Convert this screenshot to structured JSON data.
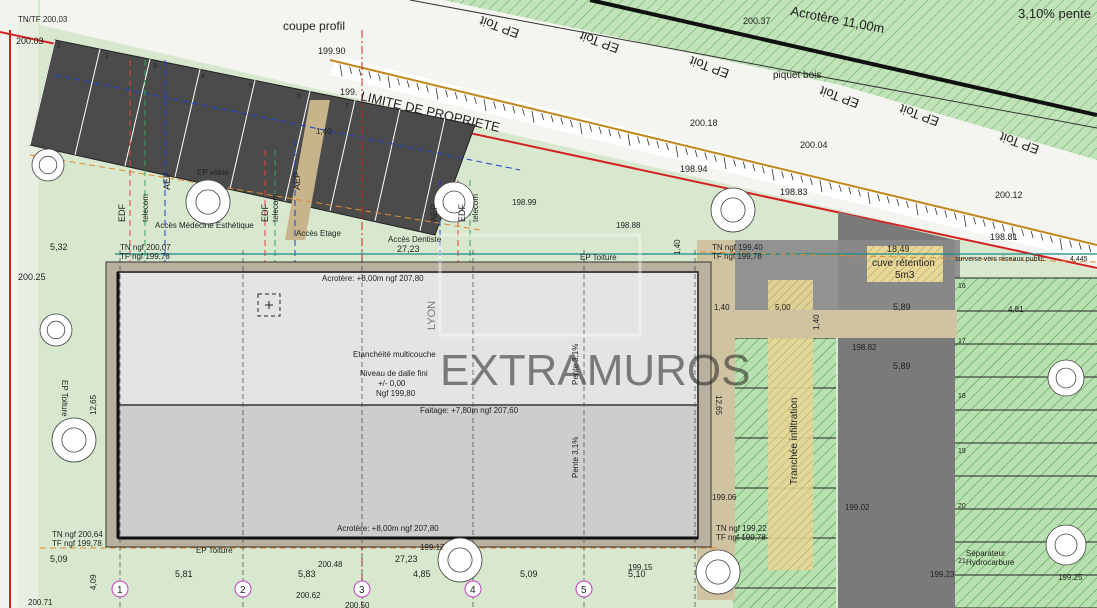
{
  "labels": {
    "tn_top_left": "TN/TF 200,03",
    "lvl_200_03": "200.03",
    "coupe_profil": "coupe profil",
    "lvl_199_90": "199.90",
    "lvl_199_xx": "199.",
    "limite_propriete": "LIMITE DE PROPRIETE",
    "acrotere_top": "Acrotère 11,00m",
    "pente_top": "3,10% pente",
    "lvl_200_37": "200.37",
    "piquet_bois": "piquet bois",
    "lvl_200_18": "200.18",
    "lvl_200_04": "200.04",
    "lvl_198_94": "198.94",
    "lvl_198_83": "198.83",
    "lvl_200_12": "200.12",
    "lvl_198_81": "198.81",
    "lvl_198_88": "198.88",
    "lvl_198_99": "198.99",
    "dim_1_40_top": "1,40",
    "ep_voirie": "EP voirie",
    "edf_1": "EDF",
    "telecom_1": "telecom",
    "aep_1": "AEP",
    "edf_2": "EDF",
    "telecom_2": "telecom",
    "aep_2": "AEP",
    "aep_3": "AEP",
    "edf_3": "EDF",
    "telecom_3": "telecom",
    "acces_medecine": "Accès Médecine Esthétique",
    "acces_etage": "Accès Etage",
    "acces_dentiste": "Accès Dentiste",
    "dim_27_23_top": "27,23",
    "tn_ngf_200_07": "TN ngf 200,07",
    "tf_ngf_199_78_a": "TF ngf 199,78",
    "dim_5_32": "5,32",
    "lvl_200_25": "200.25",
    "ep_toiture_top": "EP Toiture",
    "dim_1_40_right": "1,40",
    "tn_ngf_199_40": "TN ngf 199,40",
    "tf_ngf_199_78_b": "TF ngf 199,78",
    "dim_18_49": "18,49",
    "cuve_retention": "cuve rétention",
    "cuve_volume": "5m3",
    "surverse": "surverse vers réseaux public",
    "lvl_4_445": "4,445",
    "acrotere_8_top": "Acrotère: +8,00m ngf 207,80",
    "dim_1_40_b": "1,40",
    "dim_5_00": "5,00",
    "dim_1_40_c": "1,40",
    "dim_5_89_a": "5,89",
    "dim_4_81": "4,81",
    "lvl_198_82": "198.82",
    "dim_5_89_b": "5,89",
    "etancheite": "Etanchéité multicouche",
    "niveau_dalle": "Niveau de dalle fini",
    "dalle_zero": "+/- 0,00",
    "dalle_ngf": "Ngf 199,80",
    "pente_1": "Pente 3,1%",
    "pente_2": "Pente 3,1%",
    "faitage": "Faitage: +7,80m ngf 207,60",
    "dim_12_65_left": "12,65",
    "dim_12_65_right": "12,65",
    "ep_toiture_left": "EP Toiture",
    "tranchee": "Tranchée infiltration",
    "lvl_199_02": "199.02",
    "lvl_199_06": "199.06",
    "lvl_199_xx2": "199.",
    "acrotere_8_bottom": "Acrotère: +8,00m ngf 207,80",
    "tn_ngf_200_64": "TN ngf 200,64",
    "tf_ngf_199_78_c": "TF ngf 199,78",
    "tn_ngf_199_22": "TN ngf 199,22",
    "tf_ngf_199_78_d": "TF ngf 199,78",
    "ep_toiture_bottom": "EP Toiture",
    "lvl_199_17": "199.17",
    "dim_27_23_bottom": "27,23",
    "dim_5_09_a": "5,09",
    "dim_5_81": "5,81",
    "dim_5_83": "5,83",
    "dim_4_85": "4,85",
    "dim_5_09_b": "5,09",
    "dim_5_10": "5,10",
    "lvl_200_48": "200.48",
    "lvl_199_15": "199.15",
    "lvl_200_62": "200.62",
    "lvl_200_50": "200.50",
    "lvl_200_71": "200.71",
    "lvl_199_23": "199.23",
    "lvl_199_25": "199.25",
    "dim_4_09": "4,09",
    "separateur": "Séparateur",
    "hydrocarbure": "Hydrocarbure",
    "watermark_main": "EXTRAMUROS",
    "watermark_small": "LYON",
    "ep_toit": "EP Toit"
  },
  "axes": [
    "1",
    "2",
    "3",
    "4",
    "5"
  ],
  "slots_left": [
    "1",
    "2",
    "3",
    "4",
    "5",
    "6",
    "7"
  ],
  "slots_right": [
    "16",
    "17",
    "18",
    "19",
    "20",
    "21"
  ],
  "colors": {
    "property_line": "#d52020",
    "elec_line": "#e04040",
    "water_line": "#1c3fd0",
    "telecom_line": "#3aa05a",
    "gas_line": "#e08a30",
    "teal_line": "#1a8a8a",
    "hatch_green": "#3a9a3a",
    "roof_dark": "#4a4a4a",
    "parking_gray": "#666"
  }
}
